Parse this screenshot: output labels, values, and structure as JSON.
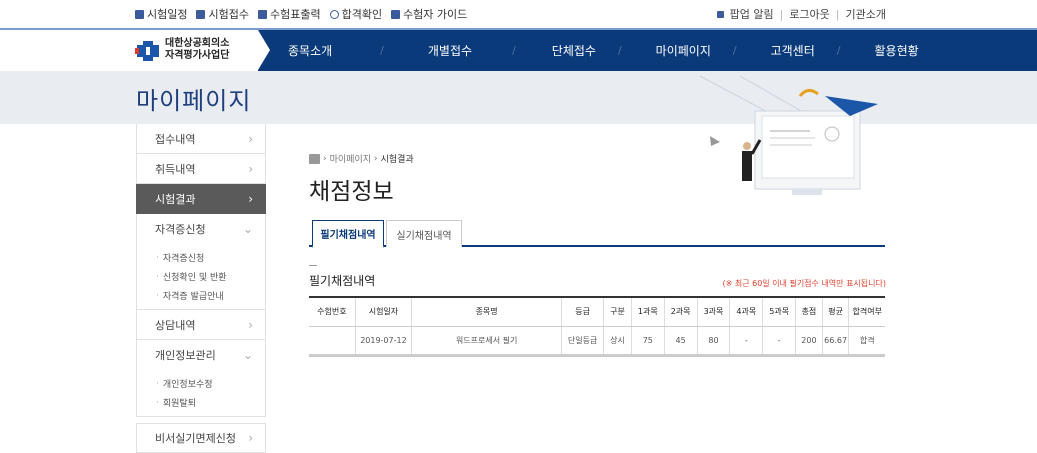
{
  "util_left": [
    {
      "label": "시험일정",
      "icon": "calendar-icon"
    },
    {
      "label": "시험접수",
      "icon": "document-icon"
    },
    {
      "label": "수험표출력",
      "icon": "print-icon"
    },
    {
      "label": "합격확인",
      "icon": "medal-icon"
    },
    {
      "label": "수험자 가이드",
      "icon": "book-icon"
    }
  ],
  "util_right": {
    "popup": "팝업 알림",
    "logout": "로그아웃",
    "about": "기관소개"
  },
  "logo": {
    "line1": "대한상공회의소",
    "line2": "자격평가사업단"
  },
  "gnb": [
    "종목소개",
    "개별접수",
    "단체접수",
    "마이페이지",
    "고객센터",
    "활용현황"
  ],
  "band_title": "마이페이지",
  "lnb": {
    "items": [
      {
        "label": "접수내역",
        "arrow": "›"
      },
      {
        "label": "취득내역",
        "arrow": "›"
      },
      {
        "label": "시험결과",
        "arrow": "›"
      },
      {
        "label": "자격증신청",
        "arrow": "⌄"
      },
      {
        "label": "상담내역",
        "arrow": "›"
      },
      {
        "label": "개인정보관리",
        "arrow": "⌄"
      },
      {
        "label": "비서실기면제신청",
        "arrow": "›"
      }
    ],
    "sub_cert": [
      "자격증신청",
      "신청확인 및 반환",
      "자격증 발급안내"
    ],
    "sub_personal": [
      "개인정보수정",
      "회원탈퇴"
    ]
  },
  "breadcrumb": {
    "sep": "›",
    "level1": "마이페이지",
    "level2": "시험결과"
  },
  "page_title": "채점정보",
  "tabs": [
    "필기채점내역",
    "실기채점내역"
  ],
  "section_title": "필기채점내역",
  "notice": "(※ 최근 60일 이내 필기점수 내역만 표시됩니다)",
  "table": {
    "headers": [
      "수험번호",
      "시험일자",
      "종목명",
      "등급",
      "구분",
      "1과목",
      "2과목",
      "3과목",
      "4과목",
      "5과목",
      "총점",
      "평균",
      "합격여부"
    ],
    "rows": [
      [
        "",
        "2019-07-12",
        "워드프로세서 필기",
        "단일등급",
        "상시",
        "75",
        "45",
        "80",
        "-",
        "-",
        "200",
        "66.67",
        "합격"
      ]
    ]
  },
  "colors": {
    "navy": "#0b3a7a",
    "active_nav": "#5a5a5a",
    "notice": "#e0412f"
  }
}
